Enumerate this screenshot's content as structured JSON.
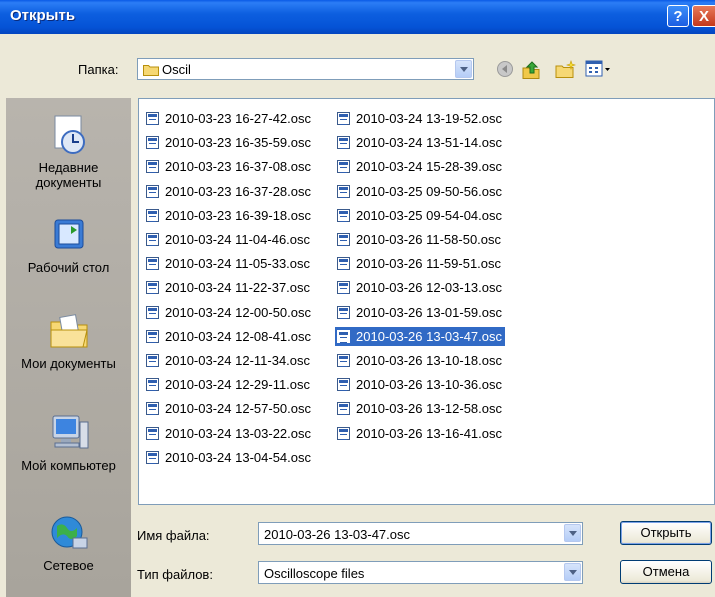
{
  "title": "Открыть",
  "title_buttons": {
    "help": "?",
    "close": "X"
  },
  "folder": {
    "label": "Папка:",
    "value": "Oscil"
  },
  "toolbar_icons": [
    "back-icon",
    "up-folder-icon",
    "new-folder-icon",
    "view-menu-icon"
  ],
  "places": [
    {
      "label": "Недавние документы",
      "icon": "recent-documents-icon"
    },
    {
      "label": "Рабочий стол",
      "icon": "desktop-icon"
    },
    {
      "label": "Мои документы",
      "icon": "my-documents-icon"
    },
    {
      "label": "Мой компьютер",
      "icon": "my-computer-icon"
    },
    {
      "label": "Сетевое",
      "icon": "network-icon"
    }
  ],
  "files_col1": [
    "2010-03-23 16-27-42.osc",
    "2010-03-23 16-35-59.osc",
    "2010-03-23 16-37-08.osc",
    "2010-03-23 16-37-28.osc",
    "2010-03-23 16-39-18.osc",
    "2010-03-24 11-04-46.osc",
    "2010-03-24 11-05-33.osc",
    "2010-03-24 11-22-37.osc",
    "2010-03-24 12-00-50.osc",
    "2010-03-24 12-08-41.osc",
    "2010-03-24 12-11-34.osc",
    "2010-03-24 12-29-11.osc",
    "2010-03-24 12-57-50.osc",
    "2010-03-24 13-03-22.osc",
    "2010-03-24 13-04-54.osc"
  ],
  "files_col2": [
    "2010-03-24 13-19-52.osc",
    "2010-03-24 13-51-14.osc",
    "2010-03-24 15-28-39.osc",
    "2010-03-25 09-50-56.osc",
    "2010-03-25 09-54-04.osc",
    "2010-03-26 11-58-50.osc",
    "2010-03-26 11-59-51.osc",
    "2010-03-26 12-03-13.osc",
    "2010-03-26 13-01-59.osc",
    "2010-03-26 13-03-47.osc",
    "2010-03-26 13-10-18.osc",
    "2010-03-26 13-10-36.osc",
    "2010-03-26 13-12-58.osc",
    "2010-03-26 13-16-41.osc"
  ],
  "selected_file": "2010-03-26 13-03-47.osc",
  "filename": {
    "label": "Имя файла:",
    "value": "2010-03-26 13-03-47.osc"
  },
  "filetype": {
    "label": "Тип файлов:",
    "value": "Oscilloscope files"
  },
  "buttons": {
    "open": "Открыть",
    "cancel": "Отмена"
  },
  "colors": {
    "titlebar": "#0553d6",
    "selection": "#316ac5",
    "dialog_bg": "#ece9d8",
    "places_bg": "#a8a49c"
  }
}
